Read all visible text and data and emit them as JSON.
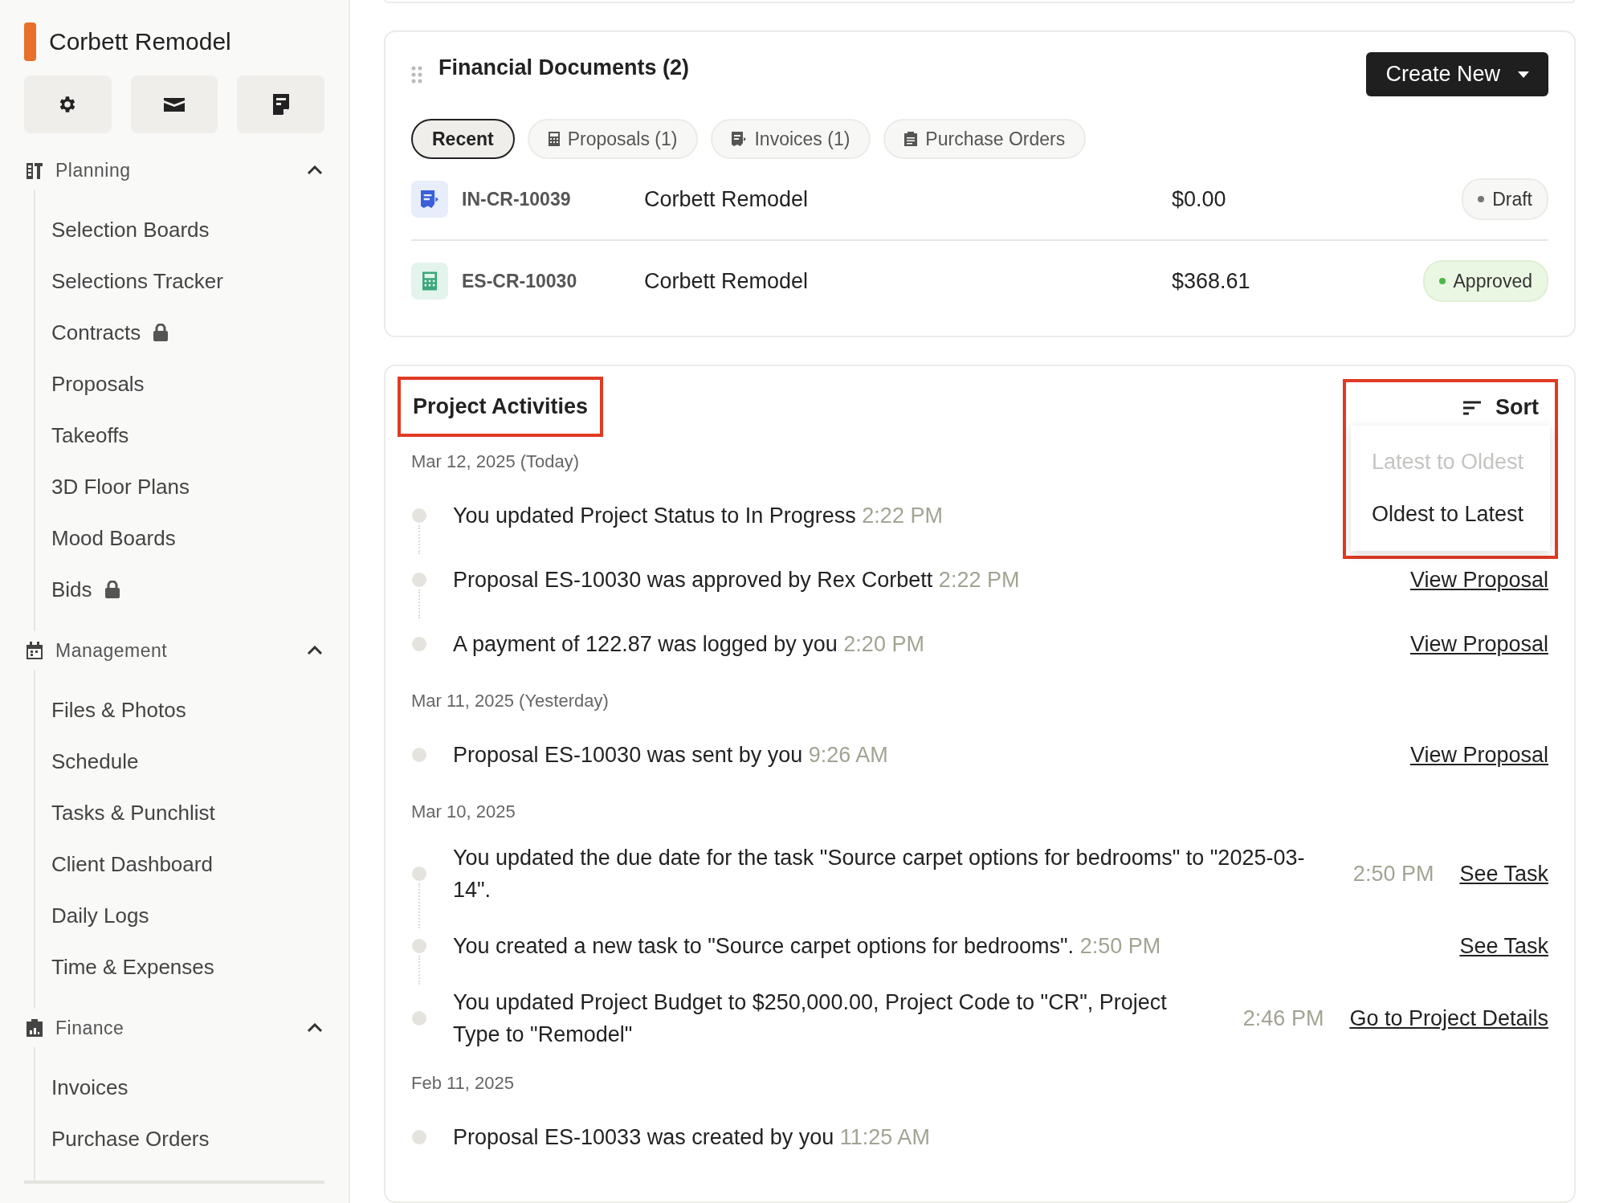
{
  "sidebar": {
    "project_name": "Corbett Remodel",
    "sections": [
      {
        "title": "Planning",
        "kind": "tools",
        "expanded": true,
        "items": [
          {
            "label": "Selection Boards",
            "locked": false
          },
          {
            "label": "Selections Tracker",
            "locked": false
          },
          {
            "label": "Contracts",
            "locked": true
          },
          {
            "label": "Proposals",
            "locked": false
          },
          {
            "label": "Takeoffs",
            "locked": false
          },
          {
            "label": "3D Floor Plans",
            "locked": false
          },
          {
            "label": "Mood Boards",
            "locked": false
          },
          {
            "label": "Bids",
            "locked": true
          }
        ]
      },
      {
        "title": "Management",
        "kind": "calendar",
        "expanded": true,
        "items": [
          {
            "label": "Files & Photos",
            "locked": false
          },
          {
            "label": "Schedule",
            "locked": false
          },
          {
            "label": "Tasks & Punchlist",
            "locked": false
          },
          {
            "label": "Client Dashboard",
            "locked": false
          },
          {
            "label": "Daily Logs",
            "locked": false
          },
          {
            "label": "Time & Expenses",
            "locked": false
          }
        ]
      },
      {
        "title": "Finance",
        "kind": "clipboard",
        "expanded": true,
        "items": [
          {
            "label": "Invoices",
            "locked": false
          },
          {
            "label": "Purchase Orders",
            "locked": false
          }
        ]
      }
    ]
  },
  "financial_documents": {
    "title": "Financial Documents (2)",
    "create_button": "Create New",
    "tabs": [
      {
        "label": "Recent",
        "kind": "plain",
        "selected": true
      },
      {
        "label": "Proposals (1)",
        "kind": "calculator",
        "selected": false
      },
      {
        "label": "Invoices (1)",
        "kind": "receipt",
        "selected": false
      },
      {
        "label": "Purchase Orders",
        "kind": "clipboard",
        "selected": false
      }
    ],
    "rows": [
      {
        "kind": "invoice",
        "number": "IN-CR-10039",
        "client": "Corbett Remodel",
        "amount": "$0.00",
        "status": "Draft",
        "color": "#777777"
      },
      {
        "kind": "proposal",
        "number": "ES-CR-10030",
        "client": "Corbett Remodel",
        "amount": "$368.61",
        "status": "Approved",
        "color": "#4cb844"
      }
    ]
  },
  "project_activities": {
    "title": "Project Activities",
    "highlighted": true,
    "sort": {
      "label": "Sort",
      "highlighted": true,
      "expanded": true,
      "options": [
        {
          "label": "Latest to Oldest",
          "disabled": true
        },
        {
          "label": "Oldest to Latest",
          "disabled": false
        }
      ]
    },
    "groups": [
      {
        "date": "Mar 12, 2025 (Today)",
        "entries": [
          {
            "text": "You updated Project Status to In Progress",
            "time": "2:22 PM",
            "time_aside": false
          },
          {
            "text": "Proposal ES-10030 was approved by Rex Corbett",
            "time": "2:22 PM",
            "time_aside": false,
            "link": "View Proposal"
          },
          {
            "text": "A payment of 122.87 was logged by you",
            "time": "2:20 PM",
            "time_aside": false,
            "link": "View Proposal"
          }
        ]
      },
      {
        "date": "Mar 11, 2025 (Yesterday)",
        "entries": [
          {
            "text": "Proposal ES-10030 was sent by you",
            "time": "9:26 AM",
            "time_aside": false,
            "link": "View Proposal"
          }
        ]
      },
      {
        "date": "Mar 10, 2025",
        "entries": [
          {
            "text": "You updated the due date for the task \"Source carpet options for bedrooms\" to \"2025-03-14\".",
            "time": "2:50 PM",
            "time_aside": true,
            "link": "See Task"
          },
          {
            "text": "You created a new task to \"Source carpet options for bedrooms\".",
            "time": "2:50 PM",
            "time_aside": false,
            "link": "See Task"
          },
          {
            "text": "You updated Project Budget to $250,000.00, Project Code to \"CR\", Project Type to \"Remodel\"",
            "time": "2:46 PM",
            "time_aside": true,
            "link": "Go to Project Details"
          }
        ]
      },
      {
        "date": "Feb 11, 2025",
        "entries": [
          {
            "text": "Proposal ES-10033 was created by you",
            "time": "11:25 AM",
            "time_aside": false
          }
        ]
      }
    ]
  }
}
